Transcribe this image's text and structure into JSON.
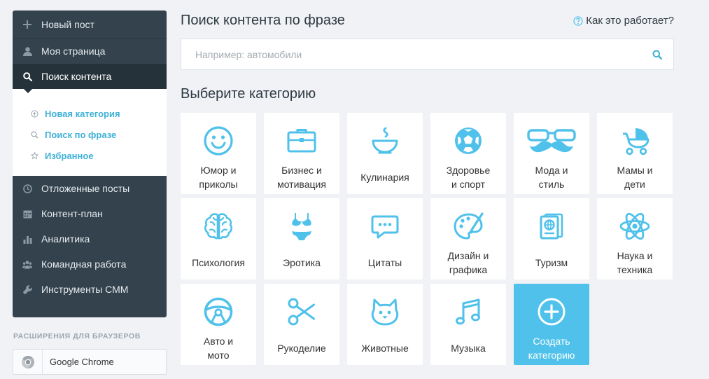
{
  "sidebar": {
    "new_post": "Новый пост",
    "my_page": "Моя страница",
    "content_search": "Поиск контента",
    "submenu": {
      "new_category": "Новая категория",
      "search_by_phrase": "Поиск по фразе",
      "favorites": "Избранное"
    },
    "scheduled_posts": "Отложенные посты",
    "content_plan": "Контент-план",
    "analytics": "Аналитика",
    "teamwork": "Командная работа",
    "smm_tools": "Инструменты СММ"
  },
  "extensions": {
    "title": "РАСШИРЕНИЯ ДЛЯ БРАУЗЕРОВ",
    "chrome_label": "Google Chrome"
  },
  "header": {
    "title": "Поиск контента по фразе",
    "help_link": "Как это работает?"
  },
  "search": {
    "placeholder": "Например: автомобили",
    "value": ""
  },
  "categories": {
    "title": "Выберите категорию",
    "items": [
      {
        "label": "Юмор и\nприколы",
        "icon": "smiley-icon"
      },
      {
        "label": "Бизнес и\nмотивация",
        "icon": "briefcase-icon"
      },
      {
        "label": "Кулинария",
        "icon": "bowl-icon"
      },
      {
        "label": "Здоровье\nи спорт",
        "icon": "soccer-ball-icon"
      },
      {
        "label": "Мода и\nстиль",
        "icon": "glasses-mustache-icon"
      },
      {
        "label": "Мамы и\nдети",
        "icon": "stroller-icon"
      },
      {
        "label": "Психология",
        "icon": "brain-icon"
      },
      {
        "label": "Эротика",
        "icon": "bikini-icon"
      },
      {
        "label": "Цитаты",
        "icon": "speech-bubble-icon"
      },
      {
        "label": "Дизайн и\nграфика",
        "icon": "palette-icon"
      },
      {
        "label": "Туризм",
        "icon": "passport-icon"
      },
      {
        "label": "Наука и\nтехника",
        "icon": "atom-icon"
      },
      {
        "label": "Авто и\nмото",
        "icon": "steering-wheel-icon"
      },
      {
        "label": "Рукоделие",
        "icon": "scissors-icon"
      },
      {
        "label": "Животные",
        "icon": "cat-icon"
      },
      {
        "label": "Музыка",
        "icon": "music-note-icon"
      }
    ],
    "create_label": "Создать\nкатегорию"
  },
  "colors": {
    "sidebar_bg": "#33424d",
    "accent": "#3fb1d7",
    "icon": "#4fc1ea"
  }
}
